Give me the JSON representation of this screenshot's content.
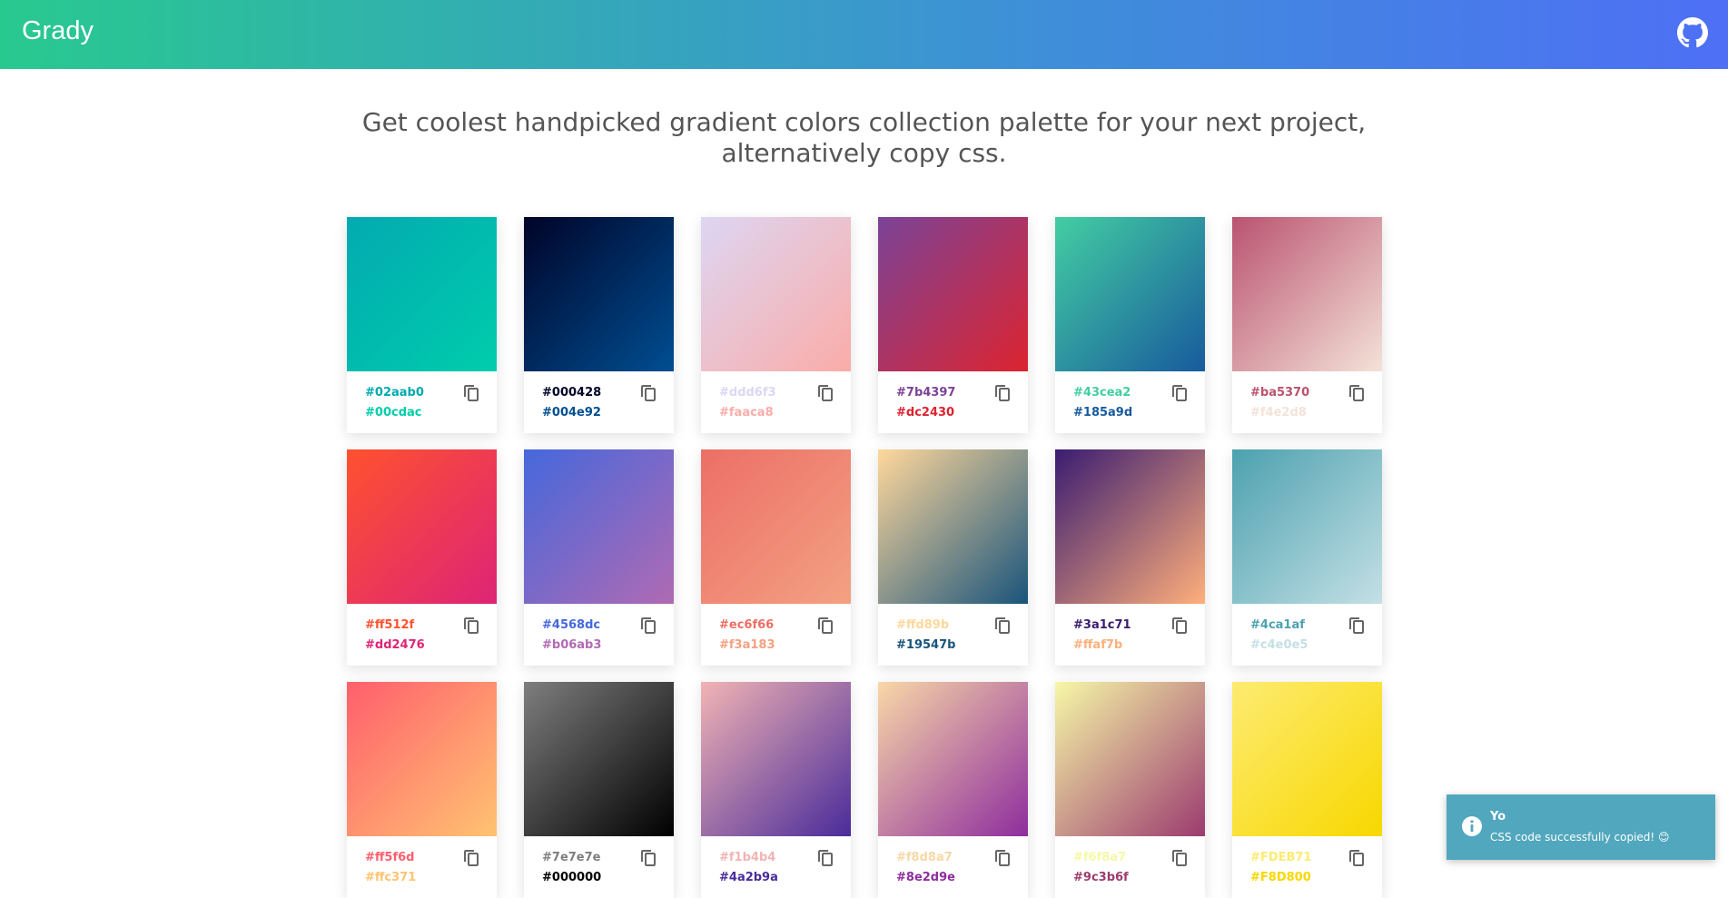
{
  "header": {
    "brand": "Grady",
    "github_icon": "github-icon"
  },
  "tagline": {
    "line1": "Get coolest handpicked gradient colors collection palette for your next project,",
    "line2": "alternatively copy css."
  },
  "gradients": [
    {
      "from": "#02aab0",
      "to": "#00cdac"
    },
    {
      "from": "#000428",
      "to": "#004e92"
    },
    {
      "from": "#ddd6f3",
      "to": "#faaca8"
    },
    {
      "from": "#7b4397",
      "to": "#dc2430"
    },
    {
      "from": "#43cea2",
      "to": "#185a9d"
    },
    {
      "from": "#ba5370",
      "to": "#f4e2d8"
    },
    {
      "from": "#ff512f",
      "to": "#dd2476"
    },
    {
      "from": "#4568dc",
      "to": "#b06ab3"
    },
    {
      "from": "#ec6f66",
      "to": "#f3a183"
    },
    {
      "from": "#ffd89b",
      "to": "#19547b"
    },
    {
      "from": "#3a1c71",
      "to": "#ffaf7b"
    },
    {
      "from": "#4ca1af",
      "to": "#c4e0e5"
    },
    {
      "from": "#ff5f6d",
      "to": "#ffc371"
    },
    {
      "from": "#7e7e7e",
      "to": "#000000"
    },
    {
      "from": "#f1b4b4",
      "to": "#4a2b9a"
    },
    {
      "from": "#f8d8a7",
      "to": "#8e2d9e"
    },
    {
      "from": "#f6f8a7",
      "to": "#9c3b6f"
    },
    {
      "from": "#FDEB71",
      "to": "#F8D800"
    }
  ],
  "toast": {
    "title": "Yo",
    "message": "CSS code successfully copied! 😊",
    "icon": "info-icon",
    "color": "#51a7be"
  }
}
